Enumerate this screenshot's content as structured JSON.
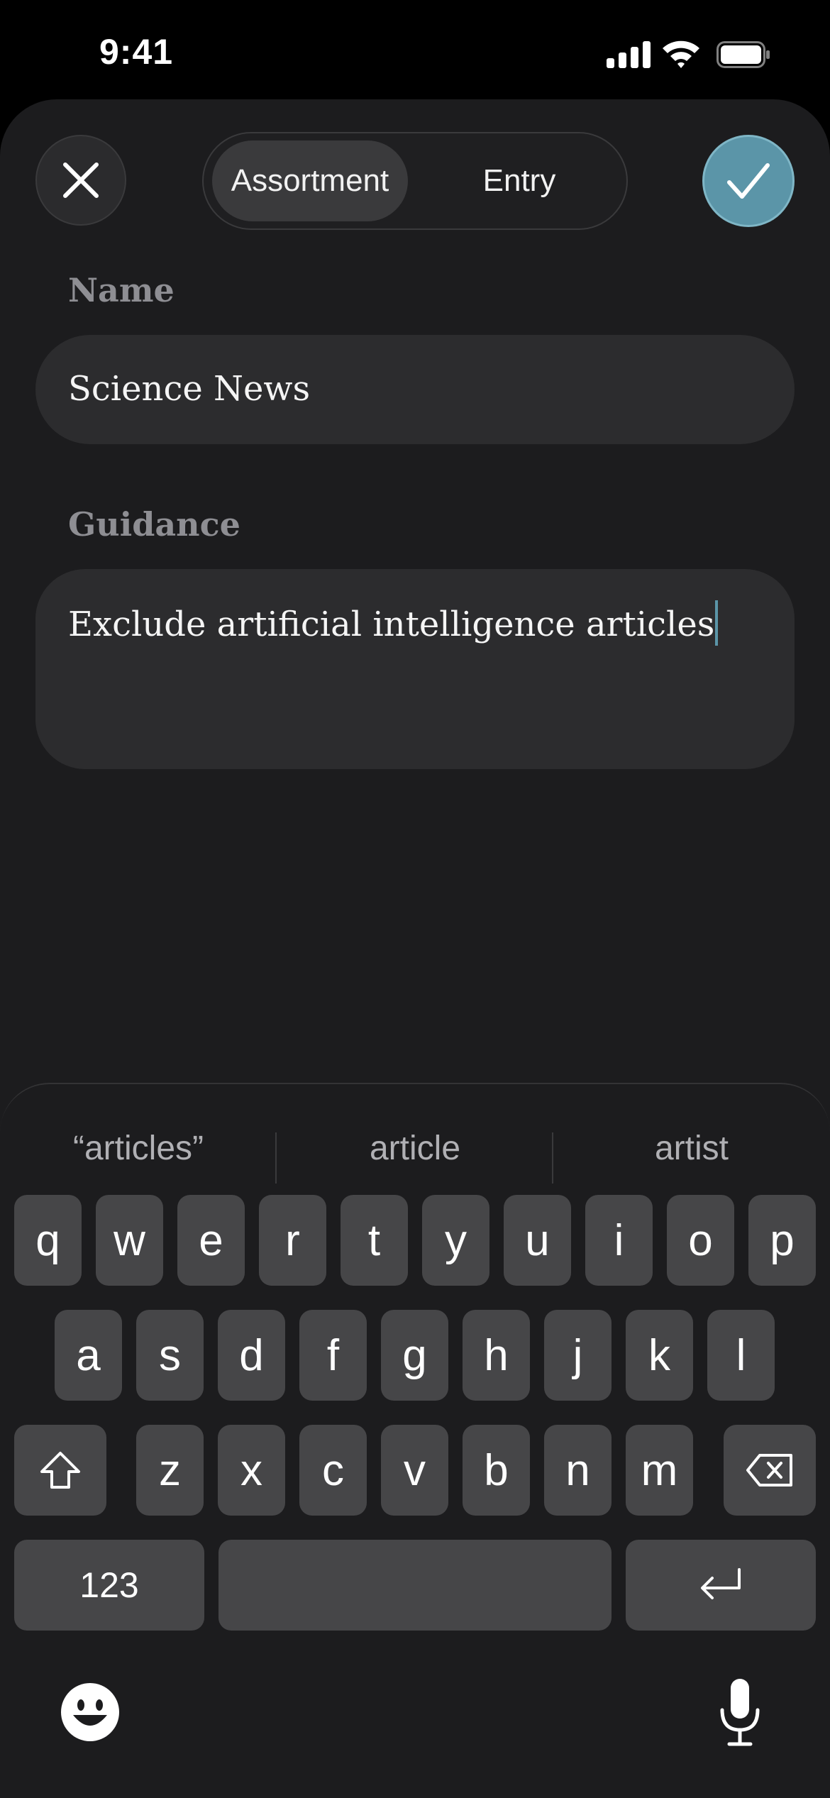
{
  "status_bar": {
    "time": "9:41"
  },
  "header": {
    "segments": [
      "Assortment",
      "Entry"
    ],
    "selected_segment": "Assortment",
    "close_icon": "close-icon",
    "confirm_icon": "checkmark-icon",
    "accent_color": "#5b95a8"
  },
  "form": {
    "name_label": "Name",
    "name_value": "Science News",
    "guidance_label": "Guidance",
    "guidance_value": "Exclude artificial intelligence articles"
  },
  "keyboard": {
    "suggestions": [
      "“articles”",
      "article",
      "artist"
    ],
    "row1": [
      "q",
      "w",
      "e",
      "r",
      "t",
      "y",
      "u",
      "i",
      "o",
      "p"
    ],
    "row2": [
      "a",
      "s",
      "d",
      "f",
      "g",
      "h",
      "j",
      "k",
      "l"
    ],
    "row3": [
      "z",
      "x",
      "c",
      "v",
      "b",
      "n",
      "m"
    ],
    "numbers_key": "123",
    "shift_icon": "shift-icon",
    "delete_icon": "delete-icon",
    "return_icon": "return-icon",
    "emoji_icon": "emoji-icon",
    "mic_icon": "microphone-icon"
  }
}
